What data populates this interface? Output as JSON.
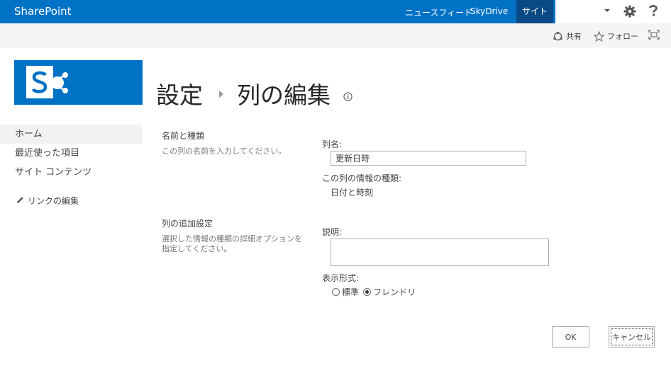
{
  "suitebar": {
    "brand": "SharePoint",
    "nav": [
      {
        "label": "ニュースフィード"
      },
      {
        "label": "SkyDrive"
      },
      {
        "label": "サイト"
      }
    ]
  },
  "ribbon": {
    "share_label": "共有",
    "follow_label": "フォロー"
  },
  "page": {
    "title": "設定",
    "title_child": "列の編集"
  },
  "quicklaunch": {
    "items": [
      {
        "label": "ホーム"
      },
      {
        "label": "最近使った項目"
      },
      {
        "label": "サイト コンテンツ"
      }
    ],
    "edit_links_label": "リンクの編集"
  },
  "form": {
    "section_name": {
      "title": "名前と種類",
      "description": "この列の名前を入力してください。"
    },
    "column_name_label": "列名:",
    "column_name_value": "更新日時",
    "column_type_label": "この列の情報の種類:",
    "column_type_value": "日付と時刻",
    "section_additional": {
      "title": "列の追加設定",
      "description": "選択した情報の種類の詳細オプションを指定してください。"
    },
    "description_label": "説明:",
    "description_value": "",
    "display_format_label": "表示形式:",
    "display_format_options": [
      {
        "label": "標準",
        "checked": false
      },
      {
        "label": "フレンドリ",
        "checked": true
      }
    ]
  },
  "buttons": {
    "ok": "OK",
    "cancel": "キャンセル"
  },
  "colors": {
    "brand_blue": "#0072c6",
    "active_nav": "#0a4a84"
  },
  "icons": {
    "logo": "sharepoint-logo-icon",
    "settings": "gear-icon",
    "help": "help-icon",
    "share": "share-icon",
    "follow": "star-icon",
    "focus": "focus-mode-icon",
    "info": "info-icon",
    "edit": "pencil-icon"
  }
}
